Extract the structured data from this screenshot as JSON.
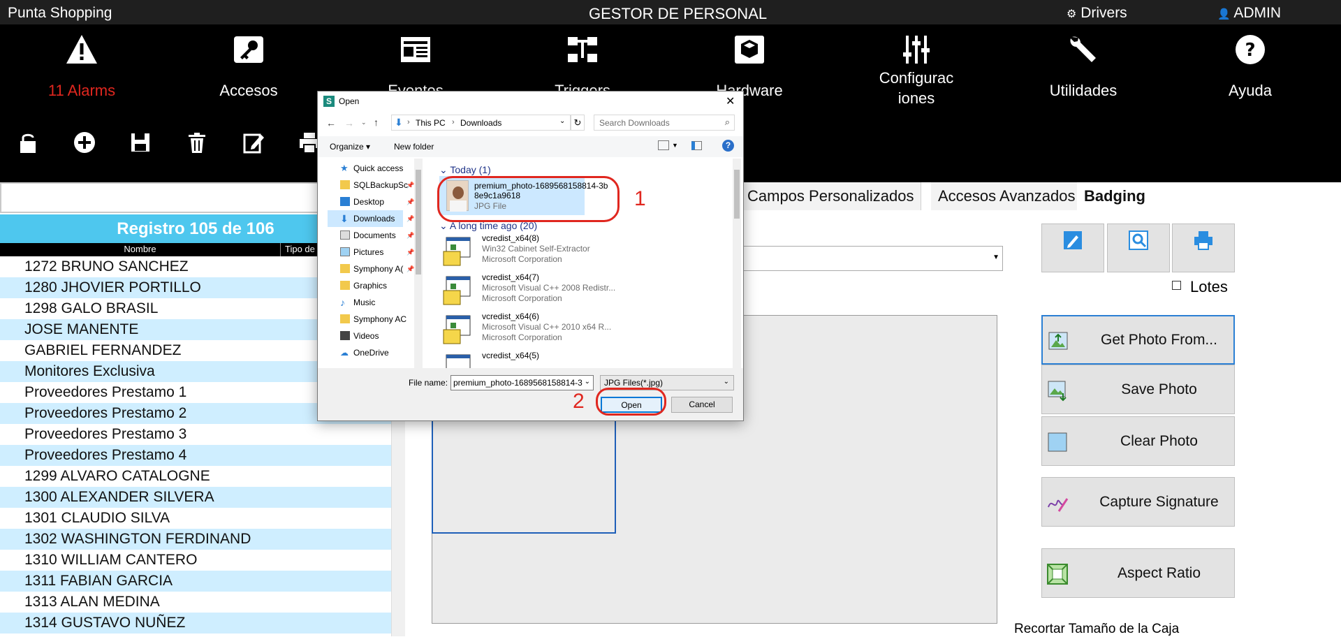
{
  "titlebar": {
    "app": "Punta Shopping",
    "title": "GESTOR DE PERSONAL",
    "drivers": "Drivers",
    "user": "ADMIN"
  },
  "ribbon": {
    "alarms": "11 Alarms",
    "accesos": "Accesos",
    "eventos": "Eventos",
    "triggers": "Triggers",
    "hardware": "Hardware",
    "configuraciones_1": "Configurac",
    "configuraciones_2": "iones",
    "utilidades": "Utilidades",
    "ayuda": "Ayuda",
    "alarm_color": "#e0271f"
  },
  "left": {
    "header": "Registro 105 de 106",
    "col_nombre": "Nombre",
    "col_tipo": "Tipo de",
    "rows": [
      "1272 BRUNO SANCHEZ",
      "1280 JHOVIER PORTILLO",
      "1298 GALO BRASIL",
      "JOSE  MANENTE",
      "GABRIEL FERNANDEZ",
      "Monitores Exclusiva",
      "Proveedores Prestamo 1",
      "Proveedores Prestamo 2",
      "Proveedores Prestamo 3",
      "Proveedores Prestamo 4",
      "1299 ALVARO CATALOGNE",
      "1300 ALEXANDER SILVERA",
      "1301 CLAUDIO SILVA",
      "1302 WASHINGTON FERDINAND",
      "1310 WILLIAM CANTERO",
      "1311 FABIAN GARCIA",
      "1313 ALAN MEDINA",
      "1314 GUSTAVO NUÑEZ"
    ]
  },
  "tabs": {
    "campos": "Campos Personalizados",
    "accesos_avanzados": "Accesos Avanzados",
    "badging": "Badging"
  },
  "right": {
    "lotes": "Lotes",
    "get_photo": "Get Photo From...",
    "save_photo": "Save Photo",
    "clear_photo": "Clear Photo",
    "capture_signature": "Capture Signature",
    "aspect_ratio": "Aspect Ratio",
    "recortar": "Recortar Tamaño de la Caja"
  },
  "dialog": {
    "title": "Open",
    "breadcrumb_1": "This PC",
    "breadcrumb_2": "Downloads",
    "search_placeholder": "Search Downloads",
    "organize": "Organize",
    "new_folder": "New folder",
    "nav": [
      "Quick access",
      "SQLBackupSc",
      "Desktop",
      "Downloads",
      "Documents",
      "Pictures",
      "Symphony A(",
      "Graphics",
      "Music",
      "Symphony AC",
      "Videos",
      "OneDrive"
    ],
    "group_today": "Today (1)",
    "group_old": "A long time ago (20)",
    "selected_file": {
      "name1": "premium_photo-1689568158814-3b",
      "name2": "8e9c1a9618",
      "type": "JPG File"
    },
    "files": [
      {
        "name": "vcredist_x64(8)",
        "desc": "Win32 Cabinet Self-Extractor",
        "company": "Microsoft Corporation"
      },
      {
        "name": "vcredist_x64(7)",
        "desc": "Microsoft Visual C++ 2008 Redistr...",
        "company": "Microsoft Corporation"
      },
      {
        "name": "vcredist_x64(6)",
        "desc": "Microsoft Visual C++ 2010  x64 R...",
        "company": "Microsoft Corporation"
      },
      {
        "name": "vcredist_x64(5)",
        "desc": "",
        "company": ""
      }
    ],
    "file_name_label": "File name:",
    "file_name_value": "premium_photo-1689568158814-3",
    "filter": "JPG Files(*.jpg)",
    "open": "Open",
    "cancel": "Cancel"
  },
  "annotations": {
    "step1": "1",
    "step2": "2",
    "color": "#e0271f"
  }
}
